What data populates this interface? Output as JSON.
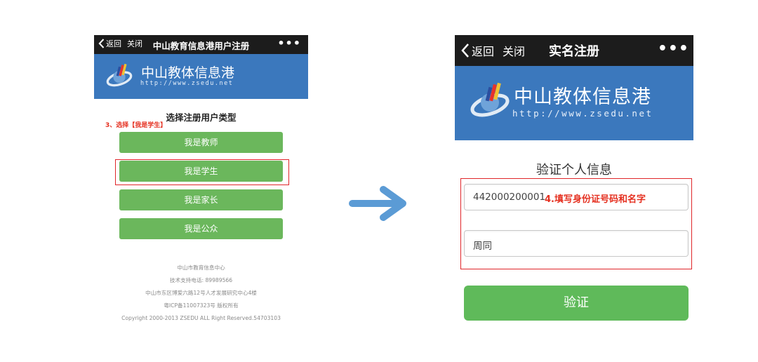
{
  "left_phone": {
    "back_label": "返回",
    "close_label": "关闭",
    "title": "中山教育信息港用户注册",
    "more": "•••",
    "logo_text": "中山教体信息港",
    "logo_url": "http://www.zsedu.net",
    "section_title": "选择注册用户类型",
    "step_note": "3、选择【我是学生】",
    "options": [
      "我是教师",
      "我是学生",
      "我是家长",
      "我是公众"
    ],
    "footer": [
      "中山市教育信息中心",
      "技术支持电话: 89989566",
      "中山市东区博爱六路12号人才发展研究中心4楼",
      "粤ICP备11007323号 版权所有",
      "Copyright 2000-2013 ZSEDU ALL Right Reserved.54703103"
    ]
  },
  "right_phone": {
    "back_label": "返回",
    "close_label": "关闭",
    "title": "实名注册",
    "more": "•••",
    "logo_text": "中山教体信息港",
    "logo_url": "http://www.zsedu.net",
    "section_title": "验证个人信息",
    "id_field_value": "442000200001",
    "step_note": "4.填写身份证号码和名字",
    "name_field_value": "周同",
    "verify_button": "验证"
  },
  "colors": {
    "topbar": "#1c1c1c",
    "banner": "#3b78bd",
    "button_green": "#6bb75c",
    "highlight_red": "#e0262a",
    "arrow_blue": "#5b9bd5"
  }
}
